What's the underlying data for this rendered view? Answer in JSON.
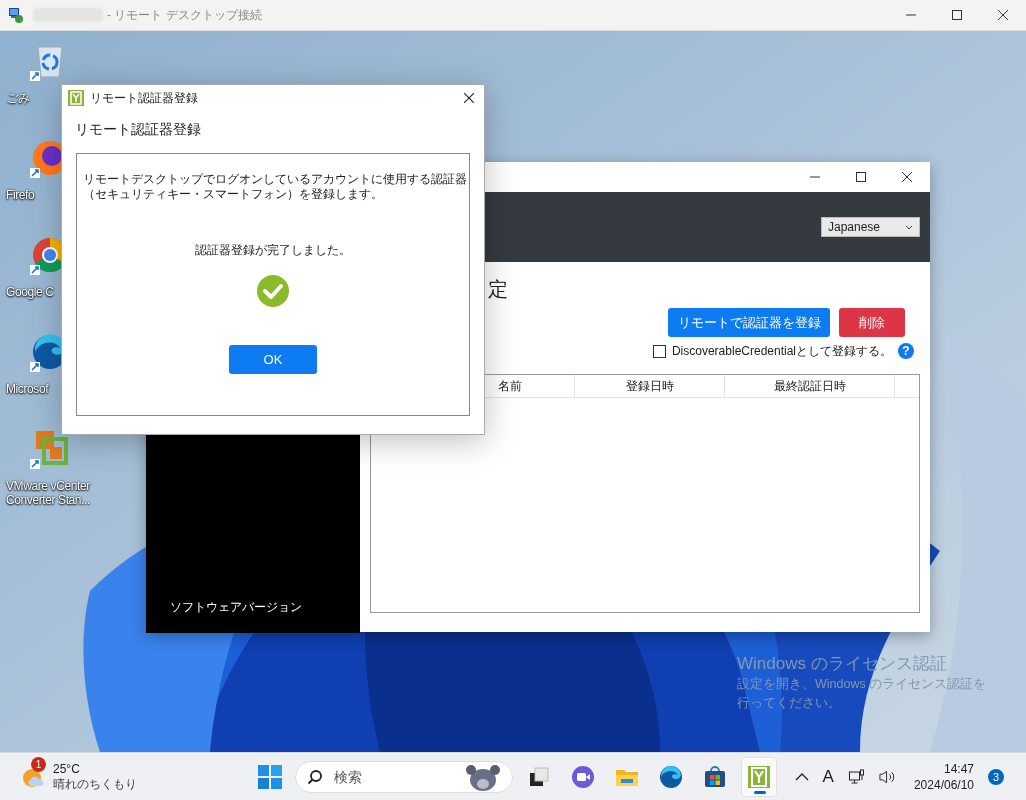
{
  "remote_window": {
    "title": "- リモート デスクトップ接続"
  },
  "desktop_icons": [
    {
      "kind": "recycle",
      "label": "ごみ"
    },
    {
      "kind": "firefox",
      "label": "Firefo"
    },
    {
      "kind": "chrome",
      "label": "Google C"
    },
    {
      "kind": "edge",
      "label": "Microsof"
    },
    {
      "kind": "vmware",
      "label": "VMware vCenter Converter Stan..."
    }
  ],
  "app_window": {
    "language_select": {
      "value": "Japanese"
    },
    "heading": "定",
    "register_button": "リモートで認証器を登録",
    "delete_button": "削除",
    "discoverable_checkbox": {
      "label": "DiscoverableCredentialとして登録する。",
      "checked": false
    },
    "help": "?",
    "table": {
      "columns": [
        "名前",
        "登録日時",
        "最終認証日時"
      ]
    },
    "sidebar": {
      "footer": "ソフトウェアバージョン"
    }
  },
  "dialog": {
    "title": "リモート認証器登録",
    "heading": "リモート認証器登録",
    "message_lines": [
      "リモートデスクトップでログオンしているアカウントに使用する認証器",
      "（セキュリティキー・スマートフォン）を登録します。"
    ],
    "status": "認証器登録が完了しました。",
    "ok_button": "OK"
  },
  "activation_notice": {
    "title": "Windows のライセンス認証",
    "body_lines": [
      "設定を開き、Windows のライセンス認証を",
      "行ってください。"
    ]
  },
  "taskbar": {
    "weather": {
      "badge": "1",
      "temperature": "25°C",
      "condition": "晴れのちくもり"
    },
    "search": {
      "placeholder": "検索"
    },
    "apps": [
      {
        "kind": "taskview",
        "active": false
      },
      {
        "kind": "meet",
        "active": false
      },
      {
        "kind": "explorer",
        "active": false
      },
      {
        "kind": "edge",
        "active": false
      },
      {
        "kind": "store",
        "active": false
      },
      {
        "kind": "authenticator",
        "active": true
      }
    ],
    "tray": {
      "ime": "A",
      "time": "14:47",
      "date": "2024/06/10",
      "notifications": "3"
    }
  }
}
